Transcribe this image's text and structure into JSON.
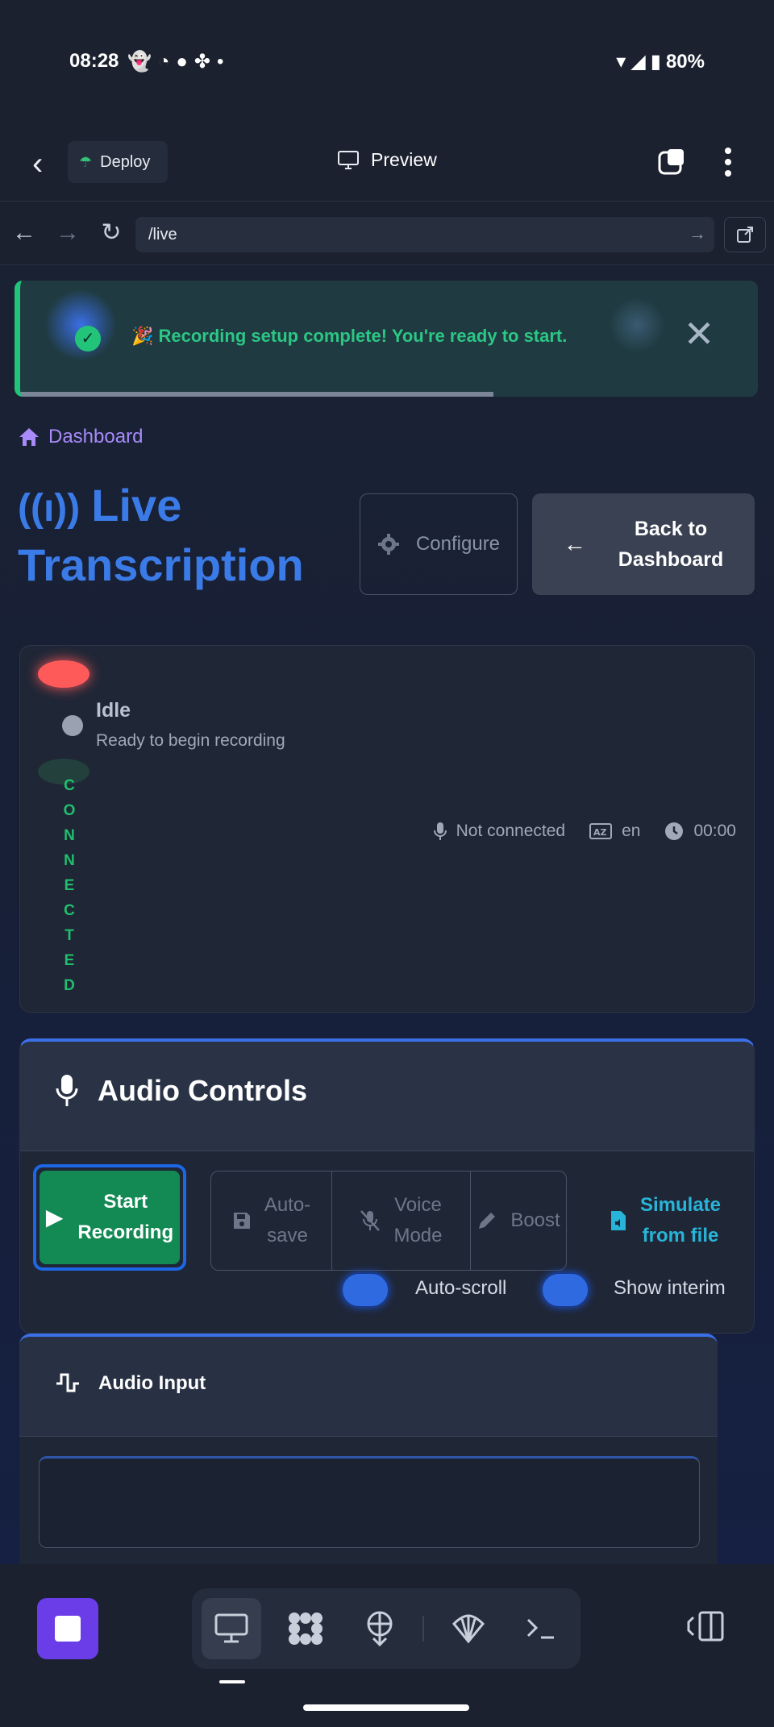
{
  "status_bar": {
    "time": "08:28",
    "battery": "80%",
    "icons": [
      "snapchat-icon",
      "whatsapp-icon",
      "chat-icon",
      "slack-icon",
      "dot-icon"
    ]
  },
  "app_bar": {
    "deploy_label": "Deploy",
    "title": "Preview"
  },
  "url_bar": {
    "url": "/live"
  },
  "toast": {
    "message": "🎉 Recording setup complete! You're ready to start.",
    "close": "✕",
    "check": "✓"
  },
  "breadcrumb": {
    "label": "Dashboard"
  },
  "header": {
    "title_line1": "Live",
    "title_line2": "Transcription",
    "configure_label": "Configure",
    "back_label_line1": "Back to",
    "back_label_line2": "Dashboard"
  },
  "status": {
    "state": "Idle",
    "subtitle": "Ready to begin recording",
    "connection_letters": [
      "C",
      "O",
      "N",
      "N",
      "E",
      "C",
      "T",
      "E",
      "D"
    ],
    "mic_status": "Not connected",
    "language": "en",
    "timer": "00:00"
  },
  "audio_controls": {
    "title": "Audio Controls",
    "start_line1": "Start",
    "start_line2": "Recording",
    "autosave_line1": "Auto-",
    "autosave_line2": "save",
    "voice_line1": "Voice",
    "voice_line2": "Mode",
    "boost": "Boost",
    "sim_line1": "Simulate",
    "sim_line2": "from file",
    "autoscroll_label": "Auto-scroll",
    "interim_label": "Show interim"
  },
  "audio_input": {
    "title": "Audio Input"
  },
  "colors": {
    "accent_blue": "#3b7be8",
    "success_green": "#22c47a",
    "record_red": "#ff5a5a",
    "purple": "#6a3de8"
  }
}
